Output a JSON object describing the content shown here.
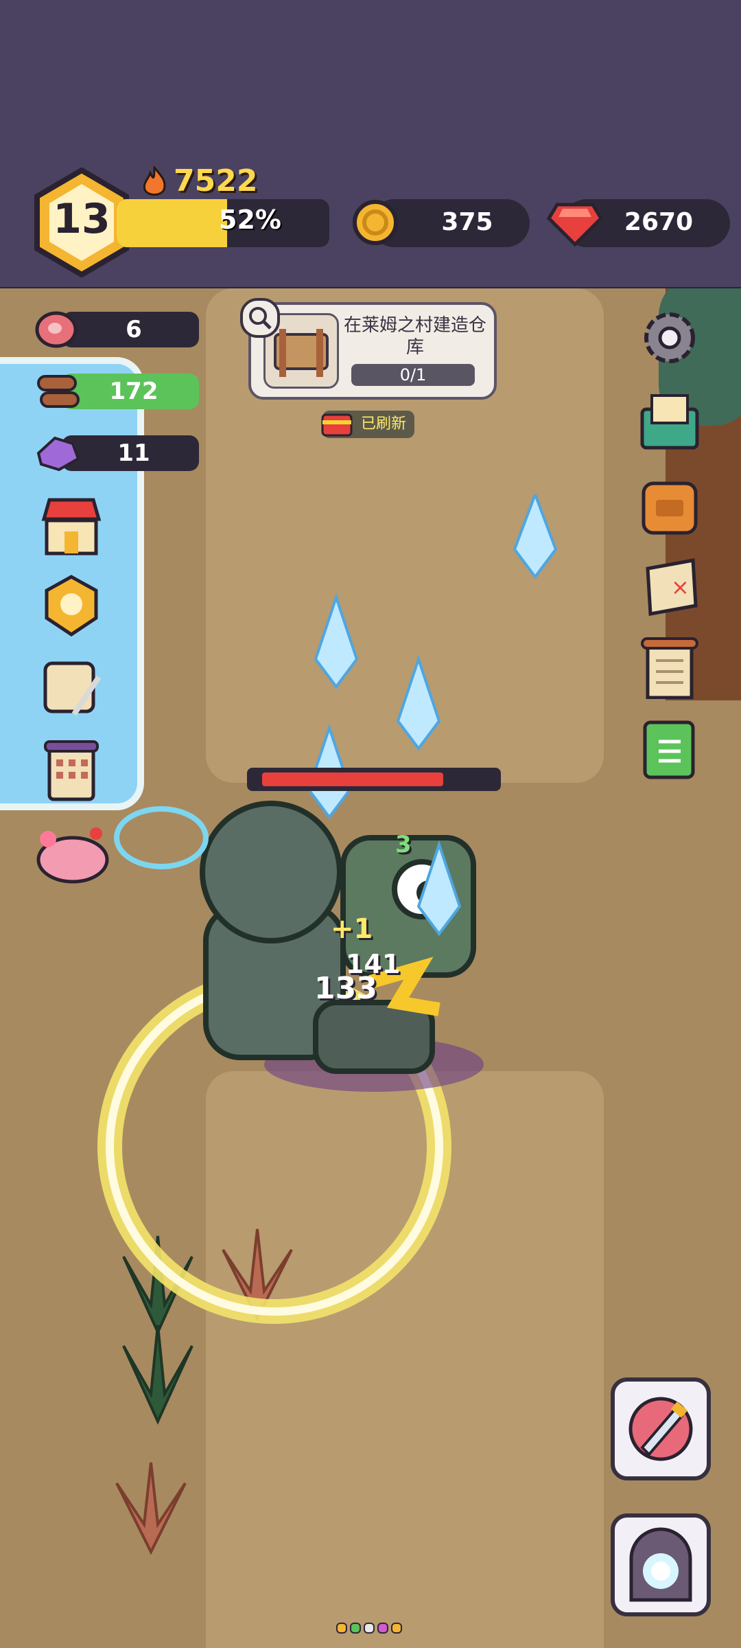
{
  "player": {
    "level": "13",
    "xp_percent": 52,
    "xp_label": "52%",
    "power": "7522"
  },
  "currencies": {
    "gold": "375",
    "gems": "2670"
  },
  "resources": [
    {
      "name": "meat-icon",
      "value": "6",
      "color": "#e8707a"
    },
    {
      "name": "wood-icon",
      "value": "172",
      "color": "#a8613a"
    },
    {
      "name": "crystal-ore-icon",
      "value": "11",
      "color": "#9f6ad8"
    }
  ],
  "quest": {
    "title": "在莱姆之村建造仓库",
    "progress": "0/1"
  },
  "refresh_label": "已刷新",
  "combat": {
    "boss_hp_fraction": 0.81,
    "damage_numbers": [
      "3",
      "+1",
      "141",
      "133"
    ]
  },
  "colors": {
    "topbar": "#4a4260",
    "ground": "#a88a60",
    "xp": "#f7d13c",
    "hp": "#e8403c",
    "gold": "#f4b531",
    "gem": "#e8403c"
  },
  "left_menu": [
    "shop-icon",
    "medal-badge-icon",
    "scroll-quill-icon",
    "calendar-scroll-icon",
    "pink-slime-pet-icon"
  ],
  "right_menu": [
    "settings-gear-icon",
    "mail-icon",
    "backpack-icon",
    "treasure-map-icon",
    "notice-scroll-icon",
    "green-book-icon"
  ],
  "bottom_buttons": [
    "auto-battle-button",
    "portal-button"
  ]
}
